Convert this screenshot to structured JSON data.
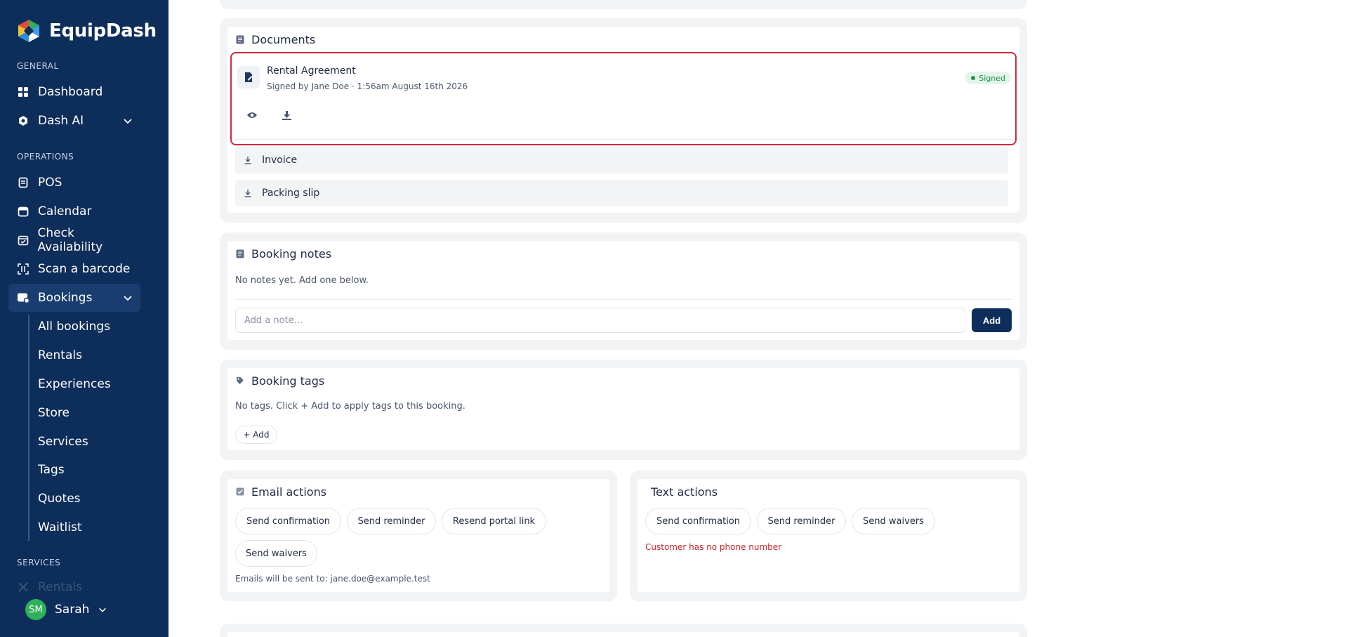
{
  "sidebar": {
    "brand": "EquipDash",
    "sections": {
      "general": "GENERAL",
      "operations": "OPERATIONS",
      "services": "SERVICES"
    },
    "general_items": {
      "dashboard": "Dashboard",
      "dash_ai": "Dash AI"
    },
    "operations_items": {
      "pos": "POS",
      "calendar": "Calendar",
      "check_availability": "Check Availability",
      "scan_barcode": "Scan a barcode",
      "bookings": "Bookings"
    },
    "booking_subitems": [
      "All bookings",
      "Rentals",
      "Experiences",
      "Store",
      "Services",
      "Tags",
      "Quotes",
      "Waitlist"
    ],
    "services_partial": "Rentals",
    "user": {
      "initials": "SM",
      "name": "Sarah"
    }
  },
  "documents": {
    "title": "Documents",
    "rental_agreement": {
      "name": "Rental Agreement",
      "meta": "Signed by Jane Doe · 1:56am August 16th 2026",
      "status": "Signed"
    },
    "files": [
      "Invoice",
      "Packing slip"
    ]
  },
  "booking_notes": {
    "title": "Booking notes",
    "empty": "No notes yet. Add one below.",
    "placeholder": "Add a note...",
    "add_label": "Add"
  },
  "booking_tags": {
    "title": "Booking tags",
    "empty": "No tags. Click + Add to apply tags to this booking.",
    "add_label": "+ Add"
  },
  "email_actions": {
    "title": "Email actions",
    "buttons": [
      "Send confirmation",
      "Send reminder",
      "Resend portal link",
      "Send waivers"
    ],
    "recipient": "Emails will be sent to: jane.doe@example.test"
  },
  "text_actions": {
    "title": "Text actions",
    "buttons": [
      "Send confirmation",
      "Send reminder",
      "Send waivers"
    ],
    "warning": "Customer has no phone number"
  },
  "colors": {
    "sidebar_bg": "#0d2d5a",
    "accent": "#0d2d5a",
    "highlight_border": "#d3283d",
    "signed_green": "#23924a",
    "warning_red": "#c62828"
  }
}
